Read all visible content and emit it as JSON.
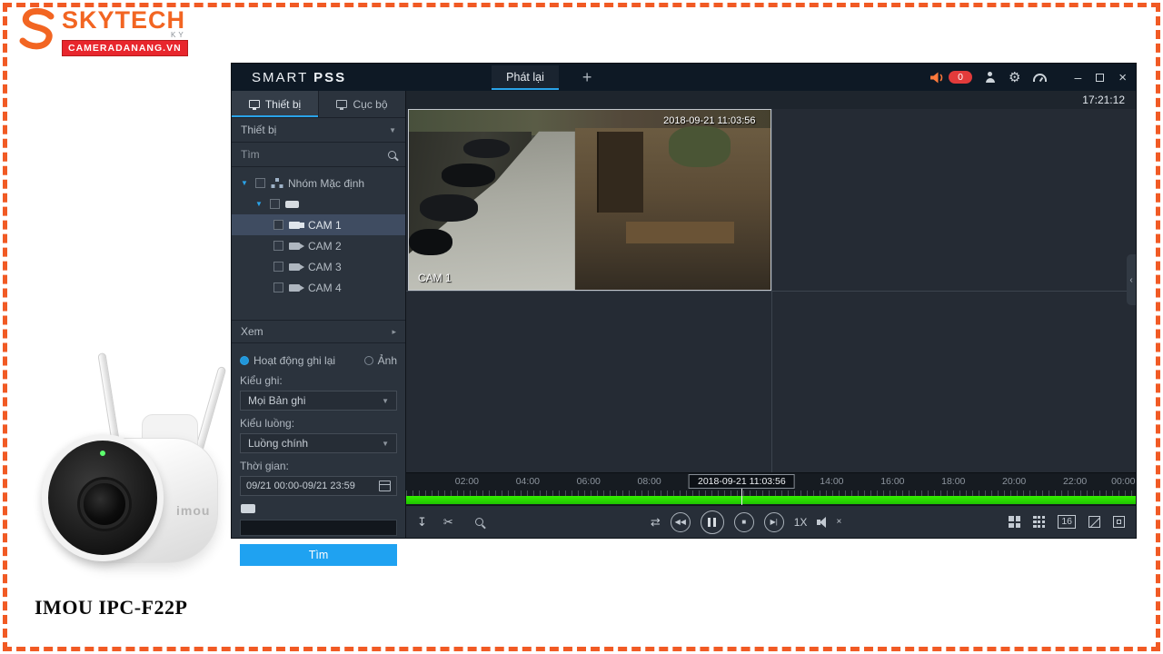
{
  "brand": {
    "name": "SKYTECH",
    "sub": "KY",
    "badge": "CAMERADANANG.VN",
    "product": "IMOU IPC-F22P",
    "imou_mark": "imou"
  },
  "titlebar": {
    "app_smart": "SMART",
    "app_pss": "PSS",
    "tab_playback": "Phát lại",
    "alarm_count": "0",
    "clock": "17:21:12"
  },
  "sidebar": {
    "tab_device": "Thiết bị",
    "tab_local": "Cục bộ",
    "device_dropdown": "Thiết bị",
    "search_placeholder": "Tìm",
    "group_label": "Nhóm Mặc định",
    "cameras": [
      "CAM 1",
      "CAM 2",
      "CAM 3",
      "CAM 4"
    ],
    "view_section": "Xem",
    "radio_record": "Hoạt động ghi lại",
    "radio_picture": "Ảnh",
    "record_type_label": "Kiểu ghi:",
    "record_type_value": "Mọi Bản ghi",
    "stream_type_label": "Kiểu luồng:",
    "stream_type_value": "Luồng chính",
    "time_label": "Thời gian:",
    "time_value": "09/21 00:00-09/21 23:59",
    "search_button": "Tìm"
  },
  "video": {
    "osd_time": "2018-09-21 11:03:56",
    "cam_label": "CAM 1"
  },
  "timeline": {
    "ticks": [
      "02:00",
      "04:00",
      "06:00",
      "08:00",
      "14:00",
      "16:00",
      "18:00",
      "20:00",
      "22:00",
      "00:00"
    ],
    "current_time": "2018-09-21 11:03:56"
  },
  "toolbar": {
    "speed": "1X",
    "split16": "16"
  },
  "icons": {
    "add_tab": "+",
    "minimize": "–",
    "close": "×",
    "gear": "⚙",
    "collapse": "‹",
    "expand": "▼",
    "arrow_right": "▸",
    "select_arrow": "▼",
    "rewind": "◀◀",
    "stop": "■",
    "step": "▶|",
    "download": "↧",
    "scissors": "✂",
    "shuffle": "⇄",
    "mute_mark": "×"
  },
  "colors": {
    "accent_blue": "#1fa2f1",
    "timeline_green": "#2ae000",
    "alarm_red": "#e23b3b",
    "brand_orange": "#f26522"
  }
}
